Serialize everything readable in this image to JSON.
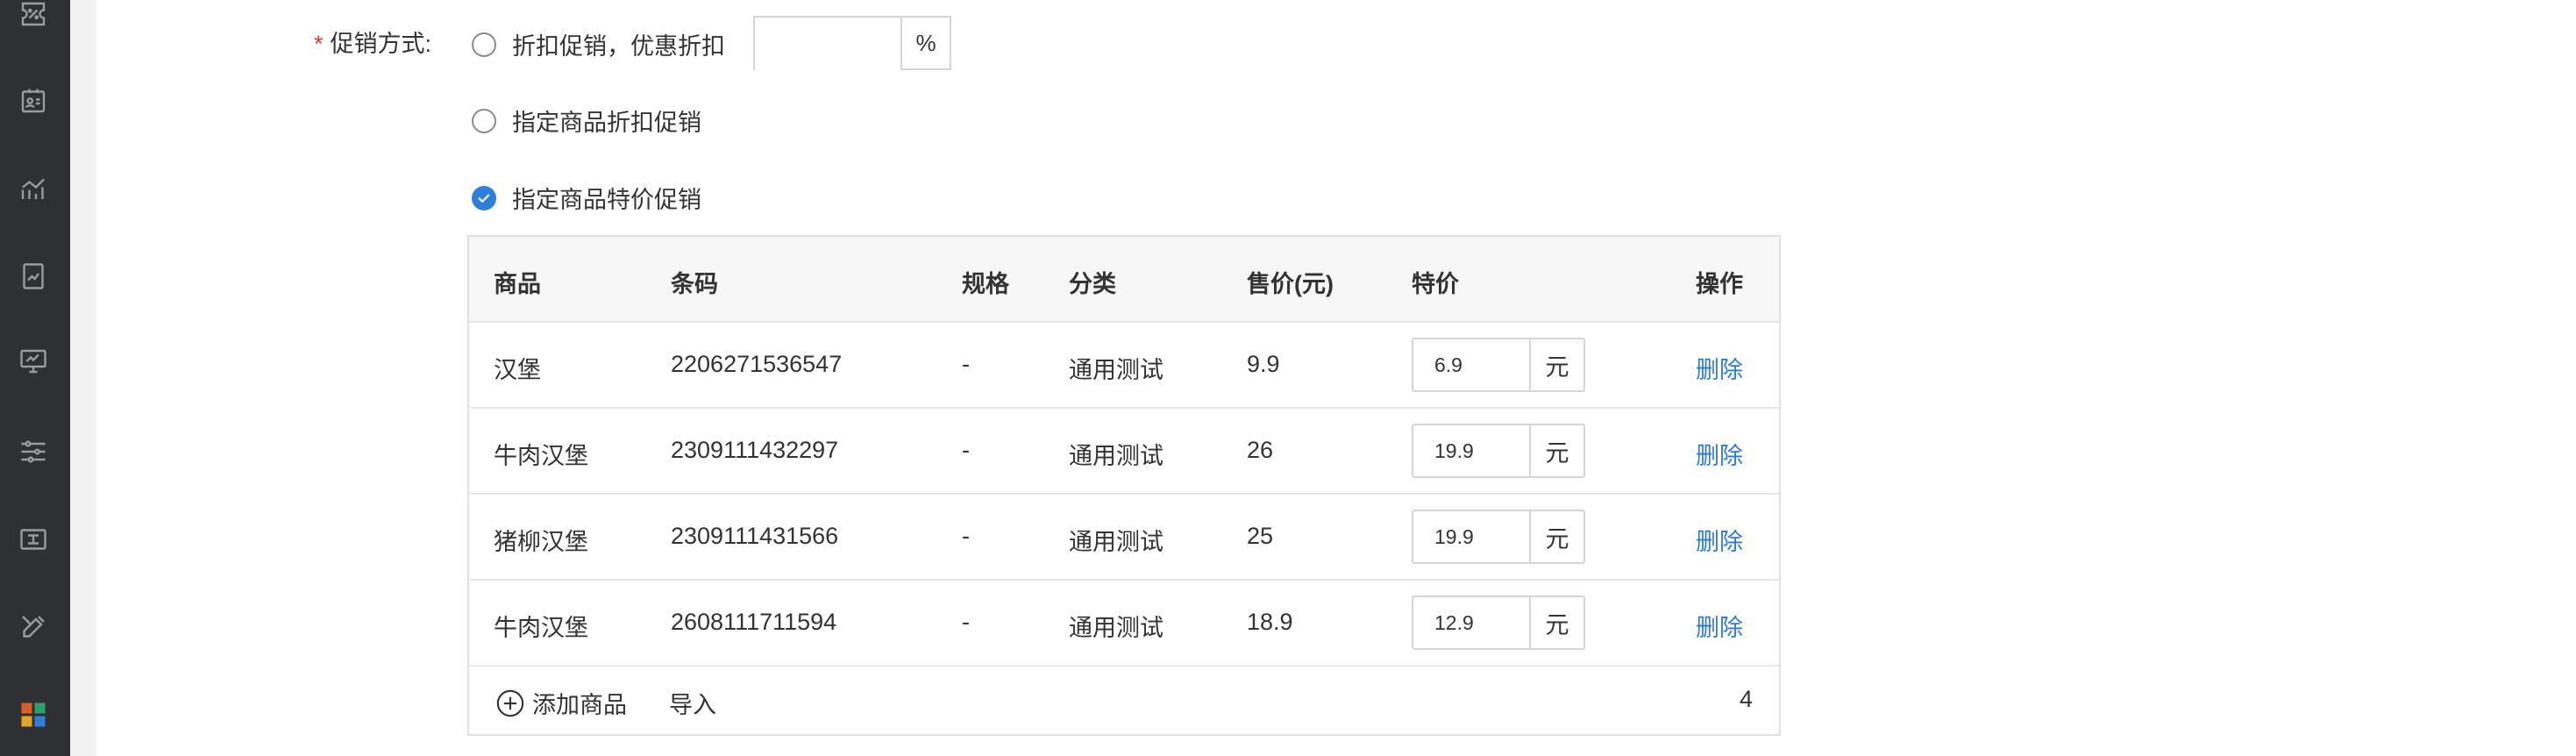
{
  "sidebar": {
    "icons": [
      "discount-icon",
      "contact-card-icon",
      "line-chart-icon",
      "report-icon",
      "monitor-icon",
      "sliders-icon",
      "ticket-icon",
      "tools-icon",
      "apps-grid-icon"
    ],
    "colors": {
      "background": "#2f3033",
      "icon": "#9a9b9e"
    }
  },
  "form": {
    "required_mark": "*",
    "label": "促销方式:",
    "options": [
      {
        "label": "折扣促销，优惠折扣",
        "checked": false
      },
      {
        "label": "指定商品折扣促销",
        "checked": false
      },
      {
        "label": "指定商品特价促销",
        "checked": true
      }
    ],
    "discount_value": "",
    "discount_suffix": "%"
  },
  "table": {
    "headers": [
      "商品",
      "条码",
      "规格",
      "分类",
      "售价(元)",
      "特价",
      "操作"
    ],
    "rows": [
      {
        "name": "汉堡",
        "barcode": "2206271536547",
        "spec": "-",
        "category": "通用测试",
        "price": "9.9",
        "special": "6.9",
        "unit": "元",
        "action": "删除"
      },
      {
        "name": "牛肉汉堡",
        "barcode": "2309111432297",
        "spec": "-",
        "category": "通用测试",
        "price": "26",
        "special": "19.9",
        "unit": "元",
        "action": "删除"
      },
      {
        "name": "猪柳汉堡",
        "barcode": "2309111431566",
        "spec": "-",
        "category": "通用测试",
        "price": "25",
        "special": "19.9",
        "unit": "元",
        "action": "删除"
      },
      {
        "name": "牛肉汉堡",
        "barcode": "2608111711594",
        "spec": "-",
        "category": "通用测试",
        "price": "18.9",
        "special": "12.9",
        "unit": "元",
        "action": "删除"
      }
    ],
    "footer": {
      "add_label": "添加商品",
      "import_label": "导入",
      "count": "4"
    }
  },
  "colors": {
    "accent": "#2f7fd9",
    "link": "#2e7ad1",
    "required": "#e0362b"
  }
}
